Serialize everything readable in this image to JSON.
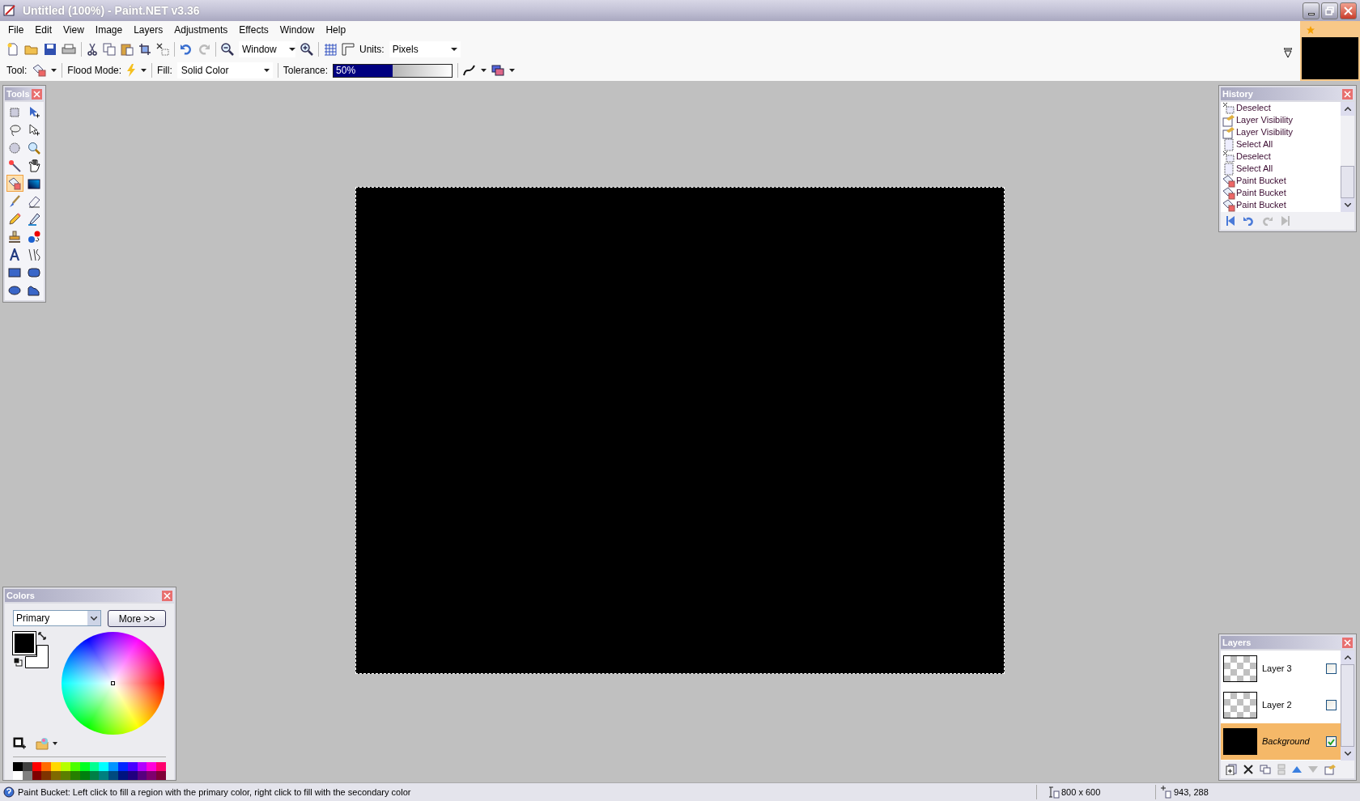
{
  "window": {
    "title": "Untitled (100%) - Paint.NET v3.36"
  },
  "menu": [
    "File",
    "Edit",
    "View",
    "Image",
    "Layers",
    "Adjustments",
    "Effects",
    "Window",
    "Help"
  ],
  "toolbar": {
    "zoom": "Window",
    "units_label": "Units:",
    "units": "Pixels"
  },
  "tool_options": {
    "tool_label": "Tool:",
    "flood_mode_label": "Flood Mode:",
    "fill_label": "Fill:",
    "fill": "Solid Color",
    "tolerance_label": "Tolerance:",
    "tolerance": "50%",
    "level": 0.5
  },
  "tools_panel": {
    "title": "Tools",
    "tools": [
      {
        "kind": "rect-select",
        "selected": false
      },
      {
        "kind": "move-selected",
        "selected": false
      },
      {
        "kind": "lasso",
        "selected": false
      },
      {
        "kind": "move-selection",
        "selected": false
      },
      {
        "kind": "ellipse-select",
        "selected": false
      },
      {
        "kind": "zoom",
        "selected": false
      },
      {
        "kind": "magic-wand",
        "selected": false
      },
      {
        "kind": "pan",
        "selected": false
      },
      {
        "kind": "paint-bucket",
        "selected": true
      },
      {
        "kind": "gradient",
        "selected": false
      },
      {
        "kind": "paintbrush",
        "selected": false
      },
      {
        "kind": "eraser",
        "selected": false
      },
      {
        "kind": "pencil",
        "selected": false
      },
      {
        "kind": "color-picker",
        "selected": false
      },
      {
        "kind": "clone-stamp",
        "selected": false
      },
      {
        "kind": "recolor",
        "selected": false
      },
      {
        "kind": "text",
        "selected": false
      },
      {
        "kind": "line",
        "selected": false
      },
      {
        "kind": "rectangle",
        "selected": false
      },
      {
        "kind": "rounded-rect",
        "selected": false
      },
      {
        "kind": "ellipse",
        "selected": false
      },
      {
        "kind": "freeform",
        "selected": false
      }
    ]
  },
  "colors_panel": {
    "title": "Colors",
    "mode": "Primary",
    "more_button": "More >>",
    "swatches": [
      {
        "kind": "primary",
        "color": "#000000"
      },
      {
        "kind": "secondary",
        "color": "#ffffff"
      }
    ],
    "palette": [
      {
        "color": "#000000"
      },
      {
        "color": "#404040"
      },
      {
        "color": "#ff0000"
      },
      {
        "color": "#ff6a00"
      },
      {
        "color": "#ffd800"
      },
      {
        "color": "#b6ff00"
      },
      {
        "color": "#4cff00"
      },
      {
        "color": "#00ff21"
      },
      {
        "color": "#00ff90"
      },
      {
        "color": "#00ffff"
      },
      {
        "color": "#0094ff"
      },
      {
        "color": "#0026ff"
      },
      {
        "color": "#4800ff"
      },
      {
        "color": "#b200ff"
      },
      {
        "color": "#ff00dc"
      },
      {
        "color": "#ff006e"
      },
      {
        "color": "#ffffff"
      },
      {
        "color": "#808080"
      },
      {
        "color": "#7f0000"
      },
      {
        "color": "#7f3300"
      },
      {
        "color": "#7f6a00"
      },
      {
        "color": "#5b7f00"
      },
      {
        "color": "#267f00"
      },
      {
        "color": "#007f0e"
      },
      {
        "color": "#007f46"
      },
      {
        "color": "#007f7f"
      },
      {
        "color": "#004a7f"
      },
      {
        "color": "#00137f"
      },
      {
        "color": "#21007f"
      },
      {
        "color": "#57007f"
      },
      {
        "color": "#7f006e"
      },
      {
        "color": "#7f0037"
      }
    ]
  },
  "history_panel": {
    "title": "History",
    "items": [
      {
        "kind": "deselect",
        "label": "Deselect"
      },
      {
        "kind": "layer-visibility",
        "label": "Layer Visibility"
      },
      {
        "kind": "layer-visibility",
        "label": "Layer Visibility"
      },
      {
        "kind": "select-all",
        "label": "Select All"
      },
      {
        "kind": "deselect",
        "label": "Deselect"
      },
      {
        "kind": "select-all",
        "label": "Select All"
      },
      {
        "kind": "paint-bucket",
        "label": "Paint Bucket"
      },
      {
        "kind": "paint-bucket",
        "label": "Paint Bucket"
      },
      {
        "kind": "paint-bucket",
        "label": "Paint Bucket"
      }
    ]
  },
  "layers_panel": {
    "title": "Layers",
    "layers": [
      {
        "name": "Layer 3",
        "kind": "transparent",
        "visible": false,
        "selected": false
      },
      {
        "name": "Layer 2",
        "kind": "transparent",
        "visible": false,
        "selected": false
      },
      {
        "name": "Background",
        "kind": "background",
        "visible": true,
        "selected": true
      }
    ]
  },
  "status_bar": {
    "message": "Paint Bucket: Left click to fill a region with the primary color, right click to fill with the secondary color",
    "image_size": "800 x 600",
    "cursor": "943, 288"
  }
}
